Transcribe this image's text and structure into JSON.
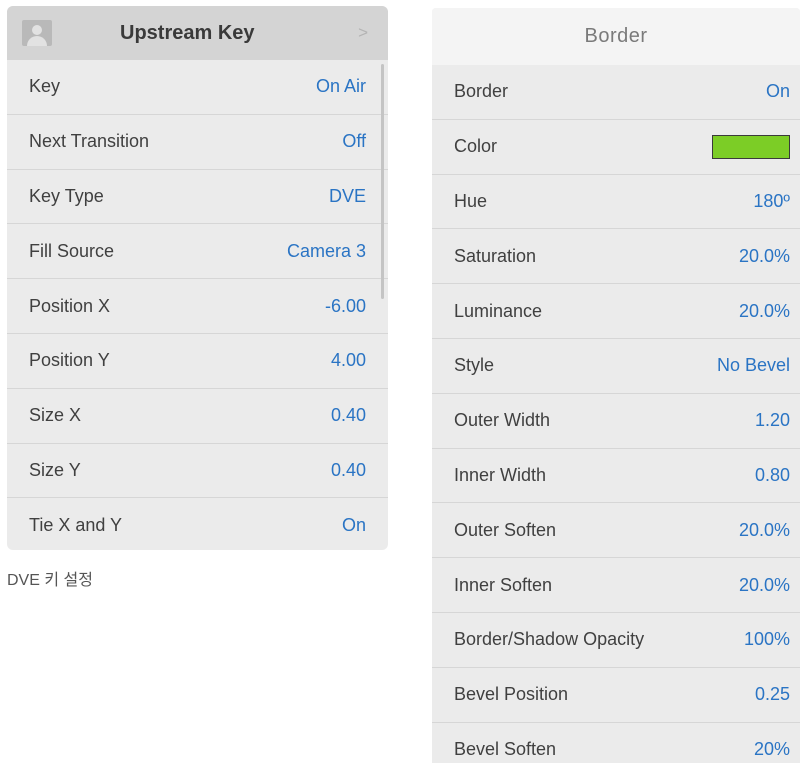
{
  "upstream_key": {
    "title": "Upstream Key",
    "icon": "user-avatar-icon",
    "nav_icon": "chevron-right-icon",
    "nav_glyph": ">",
    "rows": [
      {
        "label": "Key",
        "value": "On Air"
      },
      {
        "label": "Next Transition",
        "value": "Off"
      },
      {
        "label": "Key Type",
        "value": "DVE"
      },
      {
        "label": "Fill Source",
        "value": "Camera 3"
      },
      {
        "label": "Position X",
        "value": "-6.00"
      },
      {
        "label": "Position Y",
        "value": "4.00"
      },
      {
        "label": "Size X",
        "value": "0.40"
      },
      {
        "label": "Size Y",
        "value": "0.40"
      },
      {
        "label": "Tie X and Y",
        "value": "On"
      }
    ]
  },
  "caption": "DVE 키 설정",
  "border": {
    "title": "Border",
    "color_swatch": "#7ccd26",
    "rows": [
      {
        "label": "Border",
        "value": "On"
      },
      {
        "label": "Color",
        "value": ""
      },
      {
        "label": "Hue",
        "value": "180º"
      },
      {
        "label": "Saturation",
        "value": "20.0%"
      },
      {
        "label": "Luminance",
        "value": "20.0%"
      },
      {
        "label": "Style",
        "value": "No Bevel"
      },
      {
        "label": "Outer Width",
        "value": "1.20"
      },
      {
        "label": "Inner Width",
        "value": "0.80"
      },
      {
        "label": "Outer Soften",
        "value": "20.0%"
      },
      {
        "label": "Inner Soften",
        "value": "20.0%"
      },
      {
        "label": "Border/Shadow Opacity",
        "value": "100%"
      },
      {
        "label": "Bevel Position",
        "value": "0.25"
      },
      {
        "label": "Bevel Soften",
        "value": "20%"
      }
    ]
  },
  "colors": {
    "accent": "#2a74c4",
    "header_bg": "#d4d4d4",
    "panel_bg": "#ebebeb"
  }
}
